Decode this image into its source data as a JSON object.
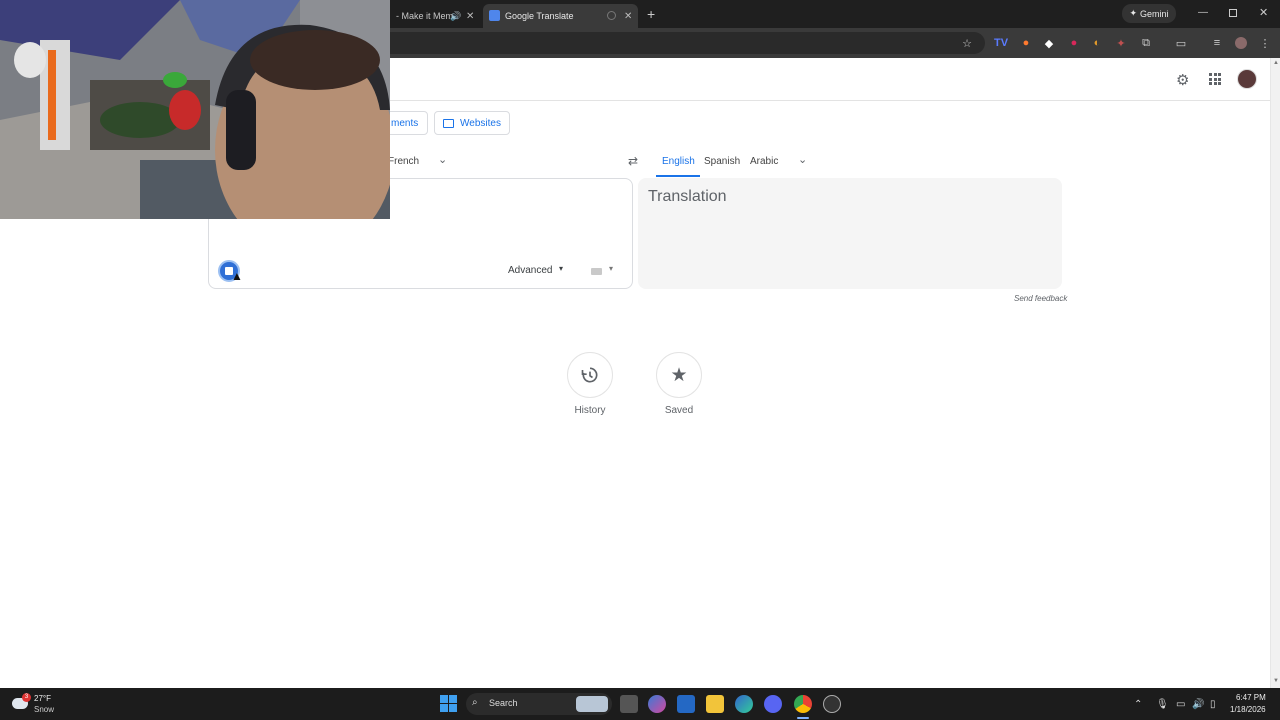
{
  "browser": {
    "tabs": [
      {
        "title": "- Make it Mem",
        "active": false
      },
      {
        "title": "Google Translate",
        "active": true
      }
    ],
    "new_tab_label": "+",
    "gemini_label": "Gemini"
  },
  "translate": {
    "modes": [
      "ments",
      "Websites"
    ],
    "source_lang": "French",
    "target_langs": [
      "English",
      "Spanish",
      "Arabic"
    ],
    "target_active": "English",
    "translation_placeholder": "Translation",
    "advanced_label": "Advanced",
    "send_feedback": "Send feedback",
    "history_label": "History",
    "saved_label": "Saved"
  },
  "taskbar": {
    "weather_temp": "27°F",
    "weather_cond": "Snow",
    "weather_badge": "3",
    "search_label": "Search",
    "time": "6:47 PM",
    "date": "1/18/2026"
  },
  "colors": {
    "accent": "#1a73e8",
    "chrome_dark": "#1f1f1f",
    "toolbar": "#3a3a3a"
  }
}
